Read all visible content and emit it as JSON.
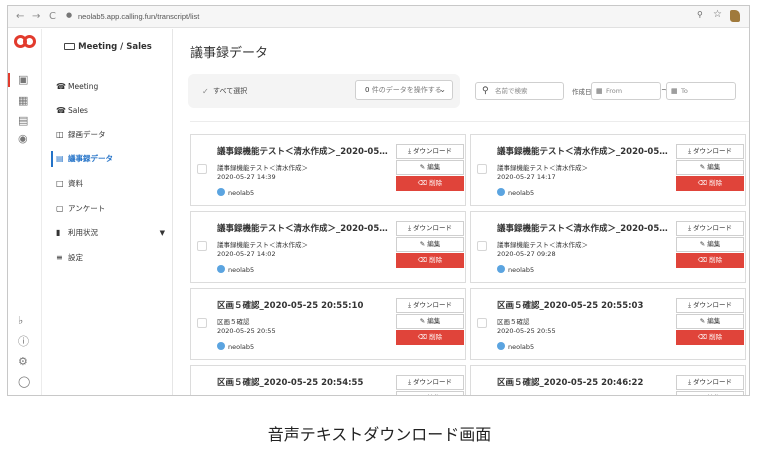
{
  "browser": {
    "back": "←",
    "forward": "→",
    "reload": "C",
    "url": "neolab5.app.calling.fun/transcript/list"
  },
  "colors": {
    "brand": "#e23b2d",
    "accent": "#2473c8",
    "delete": "#e0443a"
  },
  "rail": {
    "icons": [
      "logo-icon",
      "monitor-icon",
      "board-icon",
      "chat-icon",
      "robot-icon",
      "bell-icon",
      "help-icon",
      "gear-icon",
      "user-icon"
    ]
  },
  "sidebar": {
    "title": "Meeting / Sales",
    "items": [
      {
        "label": "Meeting",
        "icon": "phone-icon"
      },
      {
        "label": "Sales",
        "icon": "phone-icon"
      },
      {
        "label": "録画データ",
        "icon": "film-icon"
      },
      {
        "label": "議事録データ",
        "icon": "transcript-icon"
      },
      {
        "label": "資料",
        "icon": "document-icon"
      },
      {
        "label": "アンケート",
        "icon": "clipboard-icon"
      },
      {
        "label": "利用状況",
        "icon": "bar-chart-icon"
      },
      {
        "label": "設定",
        "icon": "settings-icon"
      }
    ]
  },
  "main": {
    "title": "議事録データ",
    "select_all": "すべて選択",
    "bulk": {
      "count": "0",
      "label": "件のデータを操作する"
    },
    "search_placeholder": "名前で検索",
    "date_label": "作成日",
    "from_placeholder": "From",
    "tilde": "~",
    "to_placeholder": "To",
    "buttons": {
      "download": "ダウンロード",
      "edit": "編集",
      "delete": "削除"
    }
  },
  "cards": [
    {
      "title": "議事録機能テスト＜清水作成＞_2020-05…",
      "sub": "議事録機能テスト＜清水作成＞",
      "date": "2020-05-27 14:39",
      "user": "neolab5"
    },
    {
      "title": "議事録機能テスト＜清水作成＞_2020-05…",
      "sub": "議事録機能テスト＜清水作成＞",
      "date": "2020-05-27 14:17",
      "user": "neolab5"
    },
    {
      "title": "議事録機能テスト＜清水作成＞_2020-05…",
      "sub": "議事録機能テスト＜清水作成＞",
      "date": "2020-05-27 14:02",
      "user": "neolab5"
    },
    {
      "title": "議事録機能テスト＜清水作成＞_2020-05…",
      "sub": "議事録機能テスト＜清水作成＞",
      "date": "2020-05-27 09:28",
      "user": "neolab5"
    },
    {
      "title": "区画５確認_2020-05-25 20:55:10",
      "sub": "区画５確認",
      "date": "2020-05-25 20:55",
      "user": "neolab5"
    },
    {
      "title": "区画５確認_2020-05-25 20:55:03",
      "sub": "区画５確認",
      "date": "2020-05-25 20:55",
      "user": "neolab5"
    },
    {
      "title": "区画５確認_2020-05-25 20:54:55",
      "sub": "区画５確認",
      "date": "",
      "user": ""
    },
    {
      "title": "区画５確認_2020-05-25 20:46:22",
      "sub": "",
      "date": "",
      "user": ""
    }
  ],
  "caption": "音声テキストダウンロード画面"
}
